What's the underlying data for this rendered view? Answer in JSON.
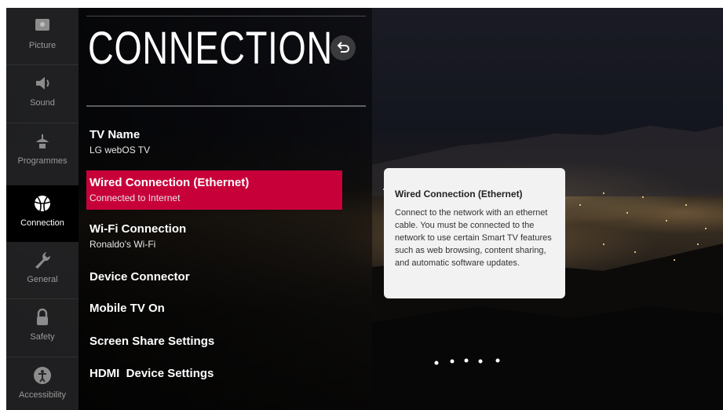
{
  "header": {
    "title": "CONNECTION"
  },
  "sidebar": {
    "items": [
      {
        "label": "Picture",
        "icon": "picture-icon"
      },
      {
        "label": "Sound",
        "icon": "speaker-icon"
      },
      {
        "label": "Programmes",
        "icon": "antenna-icon"
      },
      {
        "label": "Connection",
        "icon": "globe-icon"
      },
      {
        "label": "General",
        "icon": "wrench-icon"
      },
      {
        "label": "Safety",
        "icon": "lock-icon"
      },
      {
        "label": "Accessibility",
        "icon": "person-icon"
      }
    ],
    "active": "Connection"
  },
  "menu": {
    "items": [
      {
        "label": "TV Name",
        "sub": "LG webOS TV"
      },
      {
        "label": "Wired Connection (Ethernet)",
        "sub": "Connected to Internet"
      },
      {
        "label": "Wi-Fi Connection",
        "sub": "Ronaldo's Wi-Fi"
      },
      {
        "label": "Device Connector",
        "sub": ""
      },
      {
        "label": "Mobile TV On",
        "sub": ""
      },
      {
        "label": "Screen Share Settings",
        "sub": ""
      },
      {
        "label": "HDMI  Device Settings",
        "sub": ""
      }
    ],
    "selected": "Wired Connection (Ethernet)"
  },
  "tooltip": {
    "title": "Wired Connection (Ethernet)",
    "body": "Connect to the network with an ethernet cable. You must be connected to the network to use certain Smart TV features such as web browsing, content sharing, and automatic software updates."
  },
  "colors": {
    "accent": "#c8003a",
    "sidebar_active": "#000000",
    "tooltip_bg": "#f2f2f2"
  }
}
